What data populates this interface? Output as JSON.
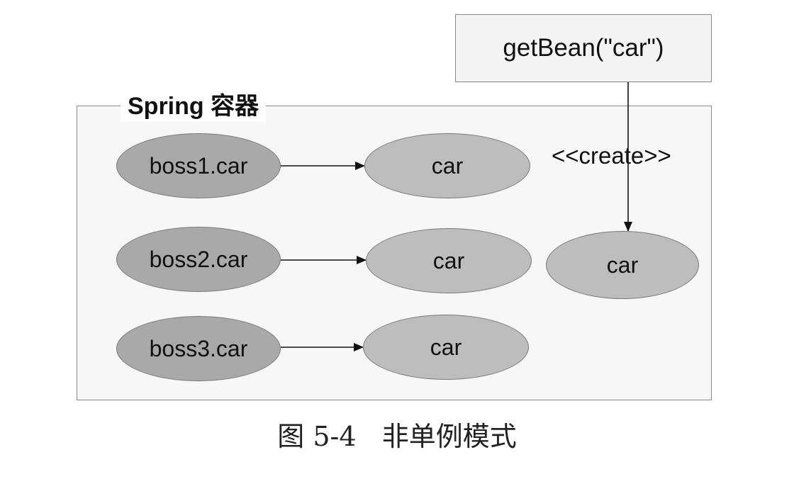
{
  "container": {
    "title": "Spring 容器"
  },
  "call": {
    "label": "getBean(\"car\")"
  },
  "create_label": "<<create>>",
  "nodes": {
    "boss1": "boss1.car",
    "boss2": "boss2.car",
    "boss3": "boss3.car",
    "car1": "car",
    "car2": "car",
    "car3": "car",
    "car_new": "car"
  },
  "caption": "图 5-4   非单例模式"
}
